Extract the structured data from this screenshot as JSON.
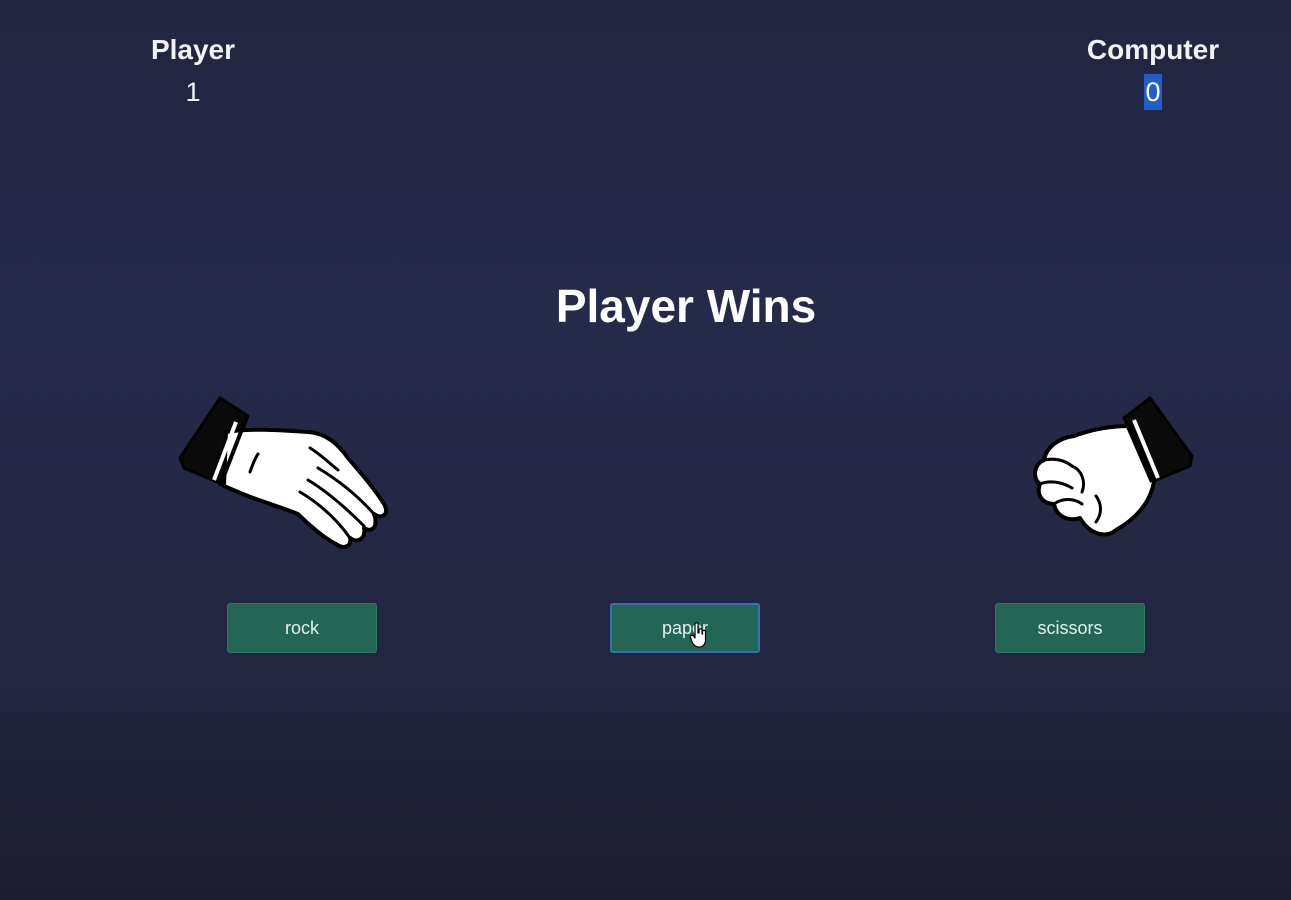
{
  "scoreboard": {
    "player": {
      "label": "Player",
      "score": "1"
    },
    "computer": {
      "label": "Computer",
      "score": "0"
    }
  },
  "result_text": "Player Wins",
  "hands": {
    "player": "paper-hand-icon",
    "computer": "rock-fist-icon"
  },
  "buttons": {
    "rock": "rock",
    "paper": "paper",
    "scissors": "scissors"
  },
  "colors": {
    "button_bg": "#236655",
    "background": "#262a4a",
    "selection": "#1f5fc9"
  }
}
